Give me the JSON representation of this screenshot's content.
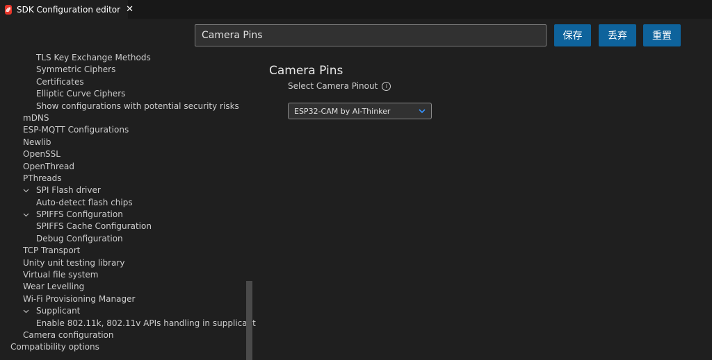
{
  "tab": {
    "title": "SDK Configuration editor",
    "close": "✕"
  },
  "search": {
    "value": "Camera Pins"
  },
  "buttons": {
    "save": "保存",
    "discard": "丢弃",
    "reset": "重置"
  },
  "tree": [
    {
      "label": "TLS Key Exchange Methods",
      "level": 2
    },
    {
      "label": "Symmetric Ciphers",
      "level": 2
    },
    {
      "label": "Certificates",
      "level": 2
    },
    {
      "label": "Elliptic Curve Ciphers",
      "level": 2
    },
    {
      "label": "Show configurations with potential security risks",
      "level": 2
    },
    {
      "label": "mDNS",
      "level": 1
    },
    {
      "label": "ESP-MQTT Configurations",
      "level": 1
    },
    {
      "label": "Newlib",
      "level": 1
    },
    {
      "label": "OpenSSL",
      "level": 1
    },
    {
      "label": "OpenThread",
      "level": 1
    },
    {
      "label": "PThreads",
      "level": 1
    },
    {
      "label": "SPI Flash driver",
      "level": 2,
      "expanded": true
    },
    {
      "label": "Auto-detect flash chips",
      "level": 2
    },
    {
      "label": "SPIFFS Configuration",
      "level": 2,
      "expanded": true
    },
    {
      "label": "SPIFFS Cache Configuration",
      "level": 2
    },
    {
      "label": "Debug Configuration",
      "level": 2
    },
    {
      "label": "TCP Transport",
      "level": 1
    },
    {
      "label": "Unity unit testing library",
      "level": 1
    },
    {
      "label": "Virtual file system",
      "level": 1
    },
    {
      "label": "Wear Levelling",
      "level": 1
    },
    {
      "label": "Wi-Fi Provisioning Manager",
      "level": 1
    },
    {
      "label": "Supplicant",
      "level": 2,
      "expanded": true
    },
    {
      "label": "Enable 802.11k, 802.11v APIs handling in supplicant",
      "level": 2
    },
    {
      "label": "Camera configuration",
      "level": 1
    },
    {
      "label": "Compatibility options",
      "level": 0
    }
  ],
  "main": {
    "heading": "Camera Pins",
    "field_label": "Select Camera Pinout",
    "select_value": "ESP32-CAM by AI-Thinker"
  },
  "icons": {
    "tab": "espressif-logo-icon",
    "expand": "chevron-down-icon",
    "info": "info-icon",
    "dropdown": "chevron-down-icon"
  }
}
